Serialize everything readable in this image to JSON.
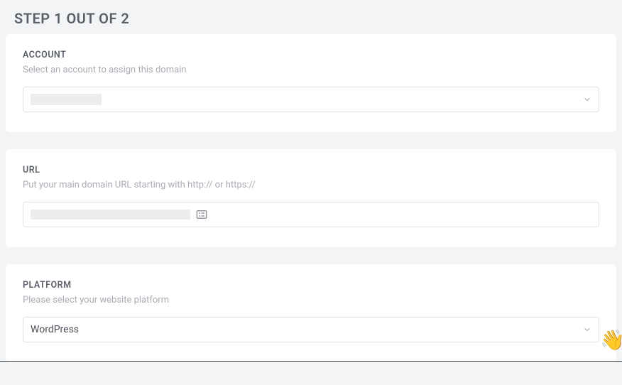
{
  "header": {
    "step_title": "STEP 1 OUT OF 2"
  },
  "account": {
    "label": "ACCOUNT",
    "helper": "Select an account to assign this domain",
    "selected_value": ""
  },
  "url": {
    "label": "URL",
    "helper": "Put your main domain URL starting with http:// or https://",
    "value": ""
  },
  "platform": {
    "label": "PLATFORM",
    "helper": "Please select your website platform",
    "selected_value": "WordPress"
  }
}
